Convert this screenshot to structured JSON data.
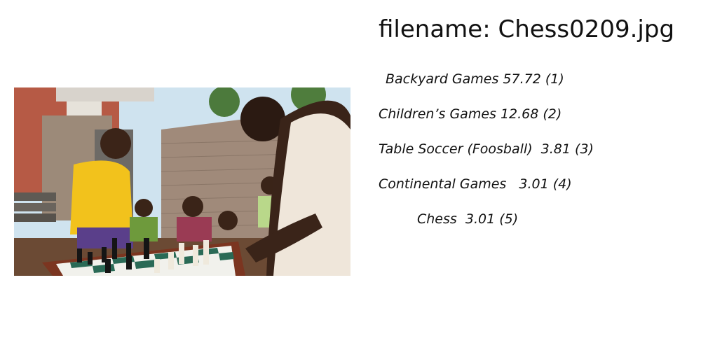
{
  "header": {
    "filename_text": "filename: Chess0209.jpg"
  },
  "photo": {
    "icon": "photo-image"
  },
  "predictions": [
    {
      "text": "Backyard Games 57.72 (1)"
    },
    {
      "text": "Children’s Games 12.68 (2)"
    },
    {
      "text": "Table Soccer (Foosball)  3.81 (3)"
    },
    {
      "text": "Continental Games   3.01 (4)"
    },
    {
      "text": "Chess  3.01 (5)"
    }
  ]
}
